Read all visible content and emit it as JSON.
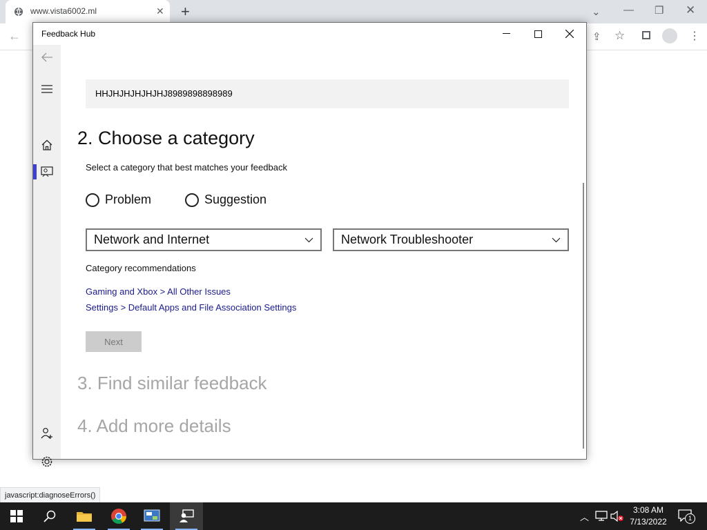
{
  "browser": {
    "tab_title": "www.vista6002.ml",
    "new_tab_symbol": "+",
    "status_url": "javascript:diagnoseErrors()"
  },
  "app": {
    "title": "Feedback Hub",
    "feedback_title_value": "HHJHJHJHJHJHJ8989898898989",
    "step2_heading": "2. Choose a category",
    "step2_subtitle": "Select a category that best matches your feedback",
    "radio_problem": "Problem",
    "radio_suggestion": "Suggestion",
    "category_select": "Network and Internet",
    "subcategory_select": "Network Troubleshooter",
    "recommendations_title": "Category recommendations",
    "recommendations": [
      "Gaming and Xbox > All Other Issues",
      "Settings > Default Apps and File Association Settings"
    ],
    "next_label": "Next",
    "step3_heading": "3. Find similar feedback",
    "step4_heading": "4. Add more details"
  },
  "taskbar": {
    "time": "3:08 AM",
    "date": "7/13/2022",
    "notification_count": "1"
  },
  "colors": {
    "accent": "#3f3fd1",
    "link": "#1a1a8c",
    "taskbar_bg": "#1c1c1c"
  }
}
